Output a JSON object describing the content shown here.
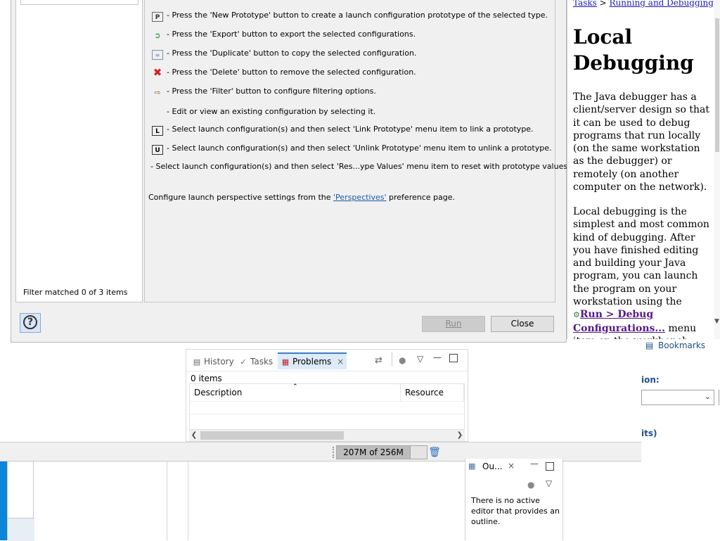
{
  "background": {
    "statusbar": {
      "heap_label": "207M of 256M"
    },
    "problems_view": {
      "tabs": [
        {
          "label": "History",
          "icon": "history-icon"
        },
        {
          "label": "Tasks",
          "icon": "tasks-icon"
        },
        {
          "label": "Problems",
          "icon": "problems-icon"
        }
      ],
      "item_count": "0 items",
      "columns": [
        "Description",
        "Resource"
      ]
    },
    "bookmarks_label": "Bookmarks",
    "ion_label": "ion:",
    "its_label": "its)",
    "outline_view": {
      "title": "Ou...",
      "message": "There is no active editor that provides an outline."
    }
  },
  "dialog": {
    "filter_status": "Filter matched 0 of 3 items",
    "instructions": [
      {
        "icon": "new-prototype-icon",
        "text": "- Press the 'New Prototype' button to create a launch configuration prototype of the selected type."
      },
      {
        "icon": "export-icon",
        "text": "- Press the 'Export' button to export the selected configurations."
      },
      {
        "icon": "duplicate-icon",
        "text": "- Press the 'Duplicate' button to copy the selected configuration."
      },
      {
        "icon": "delete-icon",
        "text": "- Press the 'Delete' button to remove the selected configuration."
      },
      {
        "icon": "filter-icon",
        "text": "- Press the 'Filter' button to configure filtering options."
      },
      {
        "icon": "",
        "text": "- Edit or view an existing configuration by selecting it."
      },
      {
        "icon": "link-prototype-icon",
        "text": "- Select launch configuration(s) and then select 'Link Prototype' menu item to link a prototype."
      },
      {
        "icon": "unlink-prototype-icon",
        "text": "- Select launch configuration(s) and then select 'Unlink Prototype' menu item to unlink a prototype."
      },
      {
        "icon": "",
        "text": "- Select launch configuration(s) and then select 'Res...ype Values' menu item to reset with prototype values."
      }
    ],
    "perspective_prefix": "Configure launch perspective settings from the ",
    "perspective_link": "'Perspectives'",
    "perspective_suffix": " preference page.",
    "run_label": "Run",
    "close_label": "Close"
  },
  "help": {
    "crumb_tasks": "Tasks",
    "crumb_sep": " > ",
    "crumb_running": "Running and Debugging",
    "title": "Local Debugging",
    "para1": "The Java debugger has a client/server design so that it can be used to debug programs that run locally (on the same workstation as the debugger) or remotely (on another computer on the network).",
    "para2_before": "Local debugging is the simplest and most common kind of debugging.  After you have finished editing and building your Java program, you can launch the program on your workstation using the ",
    "para2_link": "Run > Debug Configurations...",
    "para2_after": " menu item on the workbench."
  }
}
